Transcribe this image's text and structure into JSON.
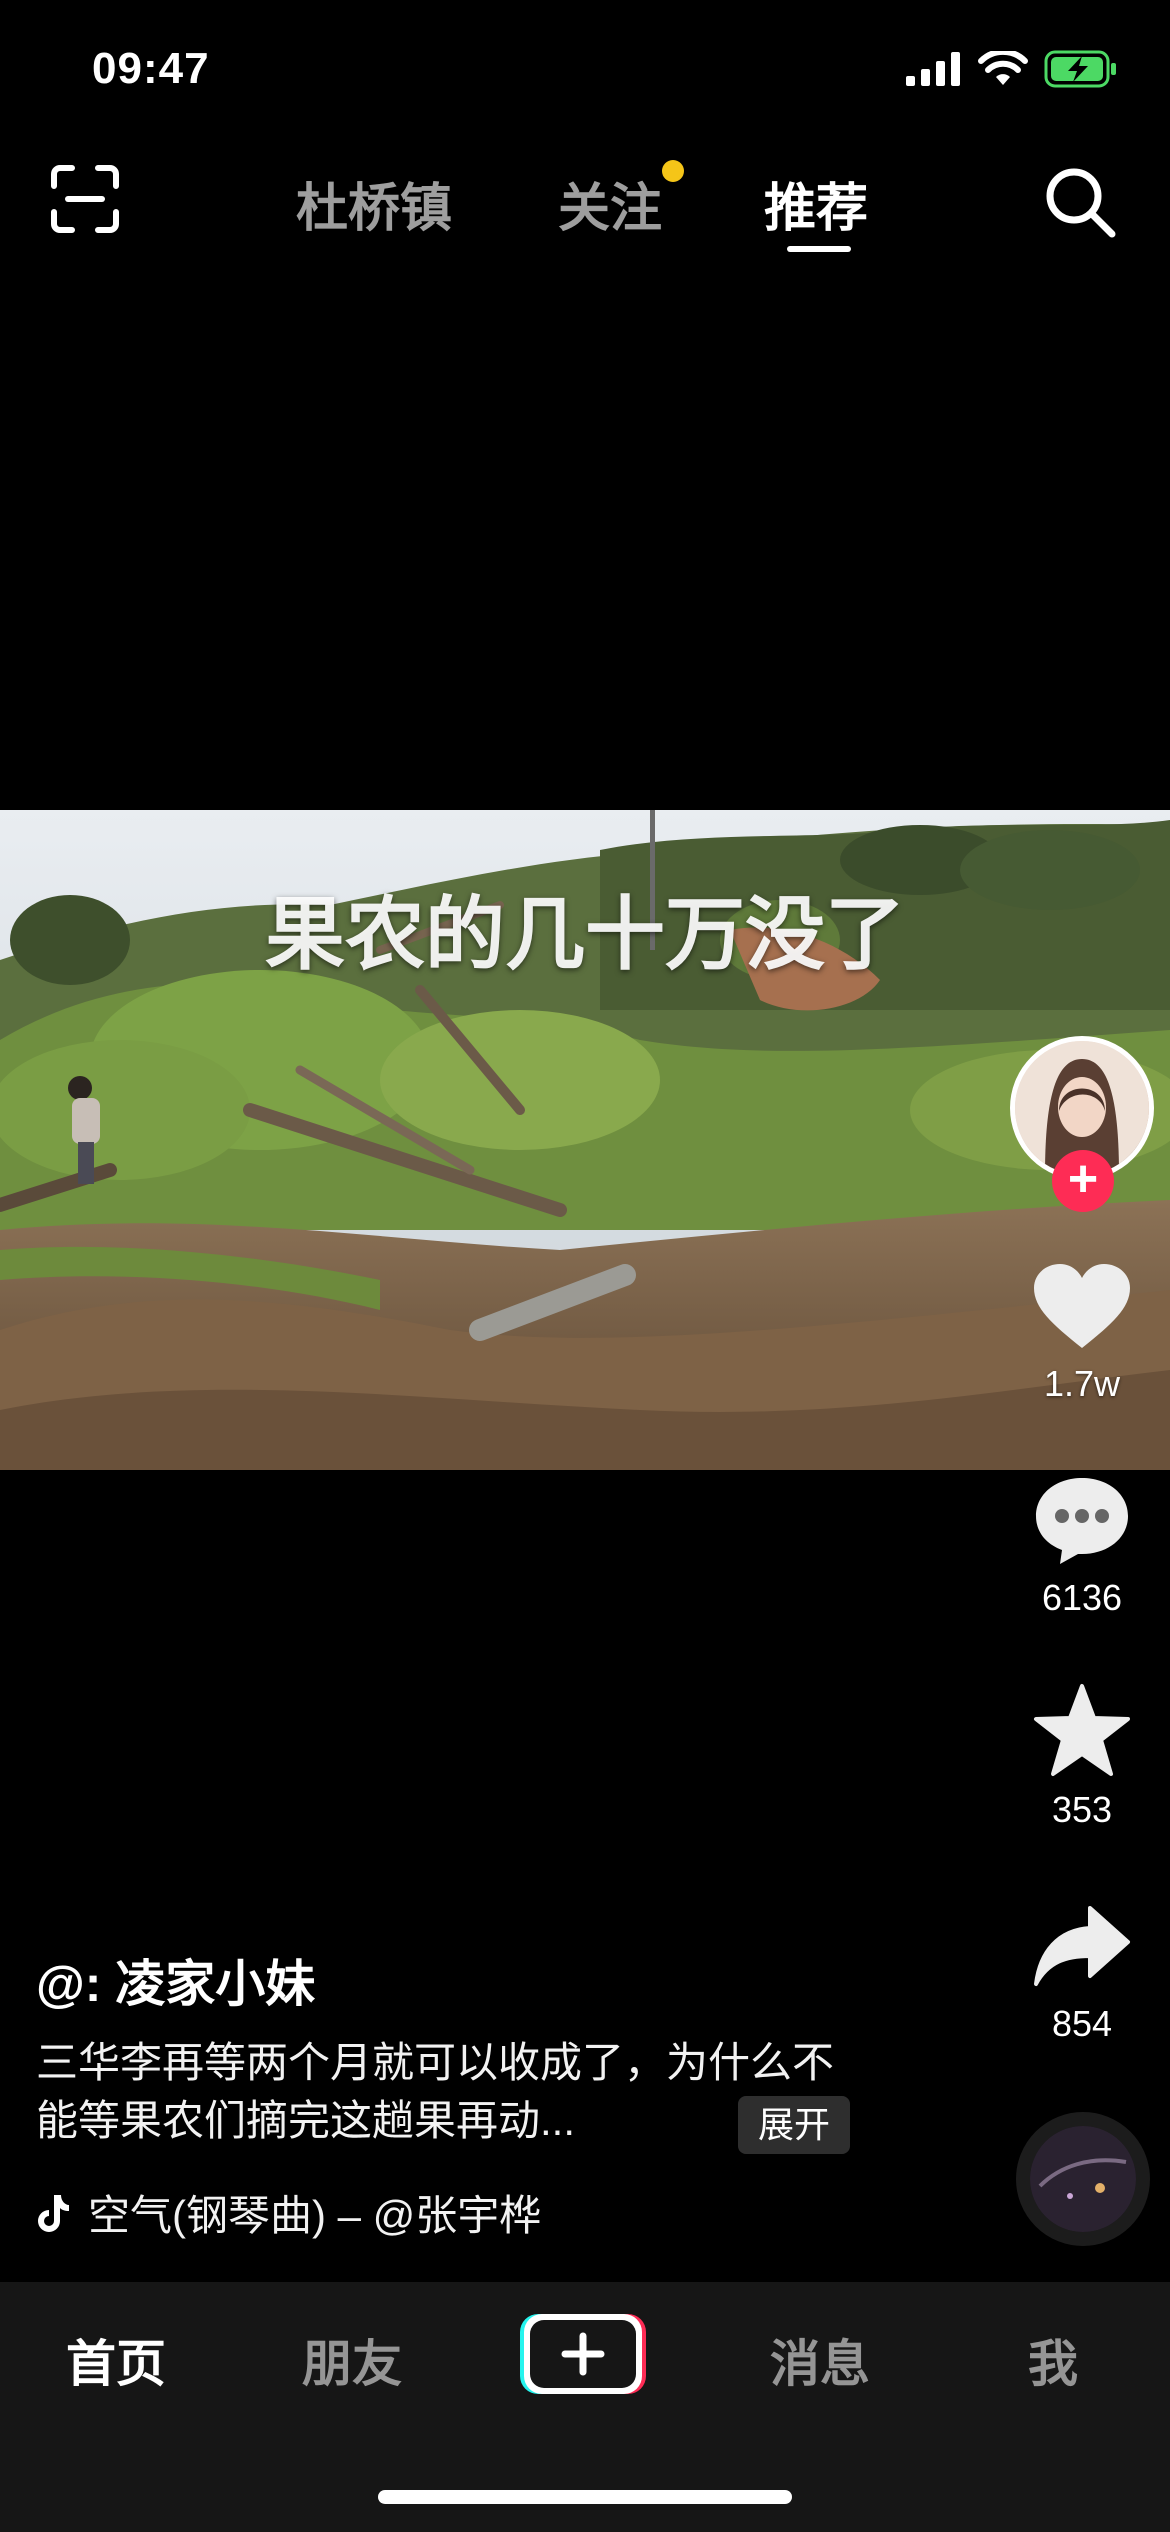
{
  "status_bar": {
    "time": "09:47"
  },
  "top_nav": {
    "tabs": [
      {
        "label": "杜桥镇"
      },
      {
        "label": "关注"
      },
      {
        "label": "推荐"
      }
    ],
    "active_tab": "推荐"
  },
  "video": {
    "caption": "果农的几十万没了"
  },
  "actions": {
    "likes": "1.7w",
    "comments": "6136",
    "favorites": "353",
    "shares": "854"
  },
  "post": {
    "author": "@:  凌家小妹",
    "description": "三华李再等两个月就可以收成了，为什么不能等果农们摘完这趟果再动...",
    "expand_label": "展开",
    "music": "空气(钢琴曲) – @张宇桦"
  },
  "tab_bar": {
    "items": [
      {
        "label": "首页"
      },
      {
        "label": "朋友"
      },
      {
        "label": "消息"
      },
      {
        "label": "我"
      }
    ],
    "active": "首页"
  },
  "colors": {
    "accent_red": "#fe2c55",
    "notification_dot": "#f5c518",
    "battery_green": "#4cd964"
  }
}
